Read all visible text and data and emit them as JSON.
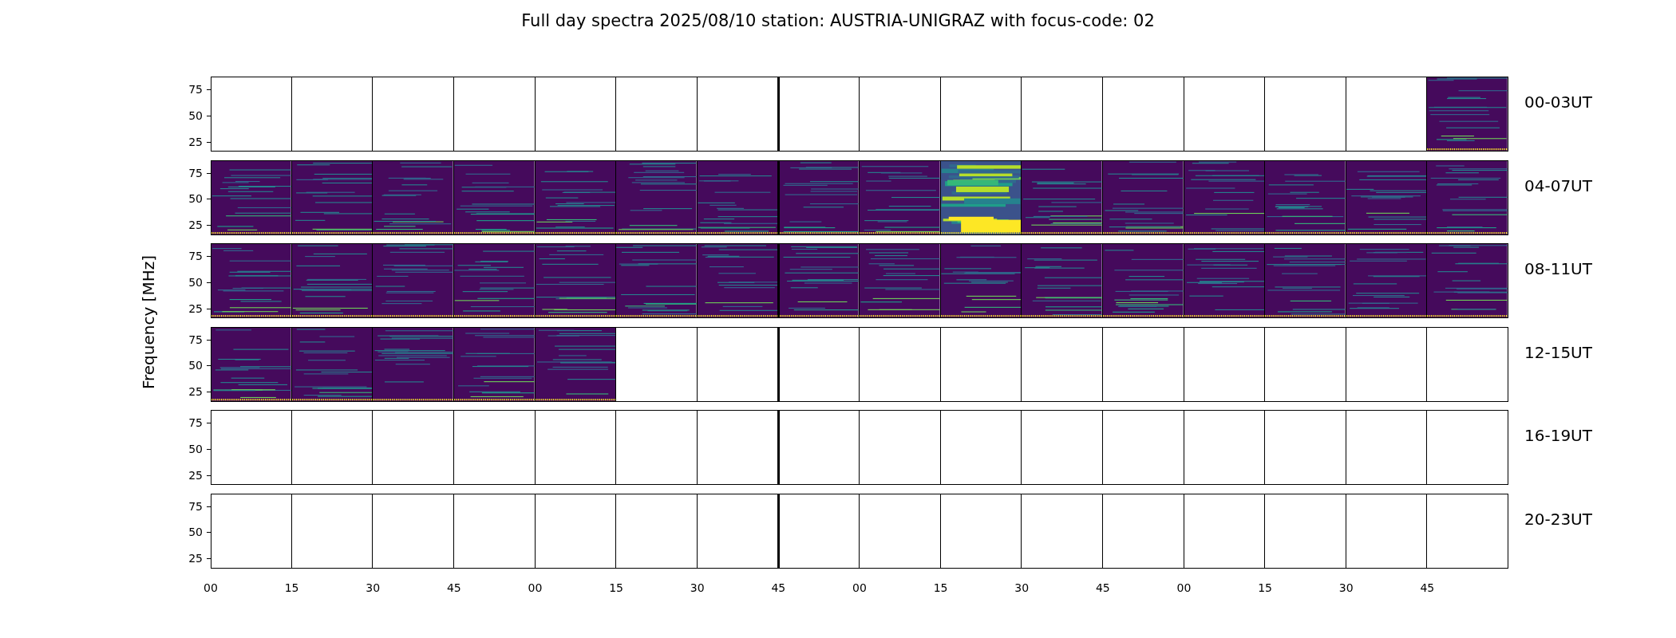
{
  "title": "Full day spectra 2025/08/10 station: AUSTRIA-UNIGRAZ with focus-code: 02",
  "ylabel": "Frequency [MHz]",
  "rows": [
    {
      "label": "00-03UT",
      "yticks": [
        "75",
        "50",
        "25"
      ],
      "panels": [
        {
          "has_data": false,
          "intense": false
        },
        {
          "has_data": false,
          "intense": false
        },
        {
          "has_data": false,
          "intense": false
        },
        {
          "has_data": false,
          "intense": false
        },
        {
          "has_data": false,
          "intense": false
        },
        {
          "has_data": false,
          "intense": false
        },
        {
          "has_data": false,
          "intense": false
        },
        {
          "has_data": false,
          "intense": false
        },
        {
          "has_data": false,
          "intense": false
        },
        {
          "has_data": false,
          "intense": false
        },
        {
          "has_data": false,
          "intense": false
        },
        {
          "has_data": false,
          "intense": false
        },
        {
          "has_data": false,
          "intense": false
        },
        {
          "has_data": false,
          "intense": false
        },
        {
          "has_data": false,
          "intense": false
        },
        {
          "has_data": true,
          "intense": false
        }
      ]
    },
    {
      "label": "04-07UT",
      "yticks": [
        "75",
        "50",
        "25"
      ],
      "panels": [
        {
          "has_data": true,
          "intense": false
        },
        {
          "has_data": true,
          "intense": false
        },
        {
          "has_data": true,
          "intense": false
        },
        {
          "has_data": true,
          "intense": false
        },
        {
          "has_data": true,
          "intense": false
        },
        {
          "has_data": true,
          "intense": false
        },
        {
          "has_data": true,
          "intense": false
        },
        {
          "has_data": true,
          "intense": false
        },
        {
          "has_data": true,
          "intense": false
        },
        {
          "has_data": true,
          "intense": true
        },
        {
          "has_data": true,
          "intense": false
        },
        {
          "has_data": true,
          "intense": false
        },
        {
          "has_data": true,
          "intense": false
        },
        {
          "has_data": true,
          "intense": false
        },
        {
          "has_data": true,
          "intense": false
        },
        {
          "has_data": true,
          "intense": false
        }
      ]
    },
    {
      "label": "08-11UT",
      "yticks": [
        "75",
        "50",
        "25"
      ],
      "panels": [
        {
          "has_data": true,
          "intense": false
        },
        {
          "has_data": true,
          "intense": false
        },
        {
          "has_data": true,
          "intense": false
        },
        {
          "has_data": true,
          "intense": false
        },
        {
          "has_data": true,
          "intense": false
        },
        {
          "has_data": true,
          "intense": false
        },
        {
          "has_data": true,
          "intense": false
        },
        {
          "has_data": true,
          "intense": false
        },
        {
          "has_data": true,
          "intense": false
        },
        {
          "has_data": true,
          "intense": false
        },
        {
          "has_data": true,
          "intense": false
        },
        {
          "has_data": true,
          "intense": false
        },
        {
          "has_data": true,
          "intense": false
        },
        {
          "has_data": true,
          "intense": false
        },
        {
          "has_data": true,
          "intense": false
        },
        {
          "has_data": true,
          "intense": false
        }
      ]
    },
    {
      "label": "12-15UT",
      "yticks": [
        "75",
        "50",
        "25"
      ],
      "panels": [
        {
          "has_data": true,
          "intense": false
        },
        {
          "has_data": true,
          "intense": false
        },
        {
          "has_data": true,
          "intense": false
        },
        {
          "has_data": true,
          "intense": false
        },
        {
          "has_data": true,
          "intense": false
        },
        {
          "has_data": false,
          "intense": false
        },
        {
          "has_data": false,
          "intense": false
        },
        {
          "has_data": false,
          "intense": false
        },
        {
          "has_data": false,
          "intense": false
        },
        {
          "has_data": false,
          "intense": false
        },
        {
          "has_data": false,
          "intense": false
        },
        {
          "has_data": false,
          "intense": false
        },
        {
          "has_data": false,
          "intense": false
        },
        {
          "has_data": false,
          "intense": false
        },
        {
          "has_data": false,
          "intense": false
        },
        {
          "has_data": false,
          "intense": false
        }
      ]
    },
    {
      "label": "16-19UT",
      "yticks": [
        "75",
        "50",
        "25"
      ],
      "panels": [
        {
          "has_data": false,
          "intense": false
        },
        {
          "has_data": false,
          "intense": false
        },
        {
          "has_data": false,
          "intense": false
        },
        {
          "has_data": false,
          "intense": false
        },
        {
          "has_data": false,
          "intense": false
        },
        {
          "has_data": false,
          "intense": false
        },
        {
          "has_data": false,
          "intense": false
        },
        {
          "has_data": false,
          "intense": false
        },
        {
          "has_data": false,
          "intense": false
        },
        {
          "has_data": false,
          "intense": false
        },
        {
          "has_data": false,
          "intense": false
        },
        {
          "has_data": false,
          "intense": false
        },
        {
          "has_data": false,
          "intense": false
        },
        {
          "has_data": false,
          "intense": false
        },
        {
          "has_data": false,
          "intense": false
        },
        {
          "has_data": false,
          "intense": false
        }
      ]
    },
    {
      "label": "20-23UT",
      "yticks": [
        "75",
        "50",
        "25"
      ],
      "panels": [
        {
          "has_data": false,
          "intense": false
        },
        {
          "has_data": false,
          "intense": false
        },
        {
          "has_data": false,
          "intense": false
        },
        {
          "has_data": false,
          "intense": false
        },
        {
          "has_data": false,
          "intense": false
        },
        {
          "has_data": false,
          "intense": false
        },
        {
          "has_data": false,
          "intense": false
        },
        {
          "has_data": false,
          "intense": false
        },
        {
          "has_data": false,
          "intense": false
        },
        {
          "has_data": false,
          "intense": false
        },
        {
          "has_data": false,
          "intense": false
        },
        {
          "has_data": false,
          "intense": false
        },
        {
          "has_data": false,
          "intense": false
        },
        {
          "has_data": false,
          "intense": false
        },
        {
          "has_data": false,
          "intense": false
        },
        {
          "has_data": false,
          "intense": false
        }
      ]
    }
  ],
  "xticks": [
    "00",
    "15",
    "30",
    "45",
    "00",
    "15",
    "30",
    "45",
    "00",
    "15",
    "30",
    "45",
    "00",
    "15",
    "30",
    "45"
  ]
}
